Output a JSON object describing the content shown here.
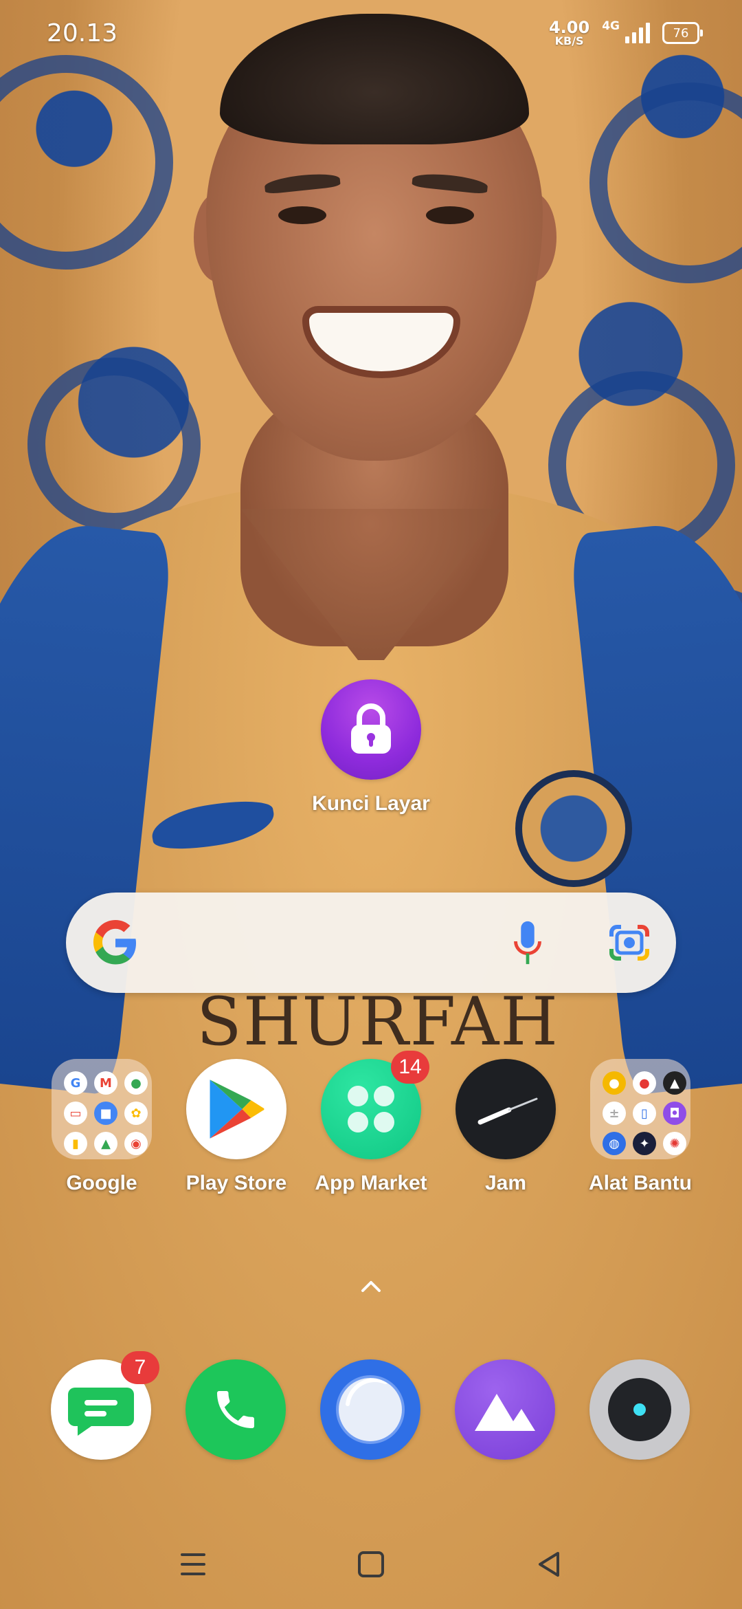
{
  "status_bar": {
    "time": "20.13",
    "net_speed_value": "4.00",
    "net_speed_unit": "KB/S",
    "network_type": "4G",
    "battery_level": "76"
  },
  "home": {
    "lock_shortcut": {
      "label": "Kunci Layar",
      "icon": "lock-icon"
    },
    "search_bar": {
      "icons": [
        "google-g-icon",
        "microphone-icon",
        "google-lens-icon"
      ]
    },
    "apps": [
      {
        "label": "Google",
        "type": "folder"
      },
      {
        "label": "Play Store",
        "icon": "play-store-icon"
      },
      {
        "label": "App Market",
        "icon": "app-market-icon",
        "badge": "14"
      },
      {
        "label": "Jam",
        "icon": "clock-icon"
      },
      {
        "label": "Alat Bantu",
        "type": "folder"
      }
    ],
    "dock": [
      {
        "name": "messages",
        "icon": "message-icon",
        "badge": "7"
      },
      {
        "name": "phone",
        "icon": "phone-icon"
      },
      {
        "name": "browser",
        "icon": "browser-icon"
      },
      {
        "name": "gallery",
        "icon": "gallery-icon"
      },
      {
        "name": "camera",
        "icon": "camera-icon"
      }
    ]
  },
  "wallpaper": {
    "sponsor_text": "SHURFAH"
  },
  "colors": {
    "lock_purple": "#9a33e0",
    "app_market_green": "#16d48c",
    "phone_green": "#1dc65a",
    "browser_blue": "#2f6fe6",
    "gallery_purple": "#8f4de8",
    "badge_red": "#e83b3b"
  }
}
